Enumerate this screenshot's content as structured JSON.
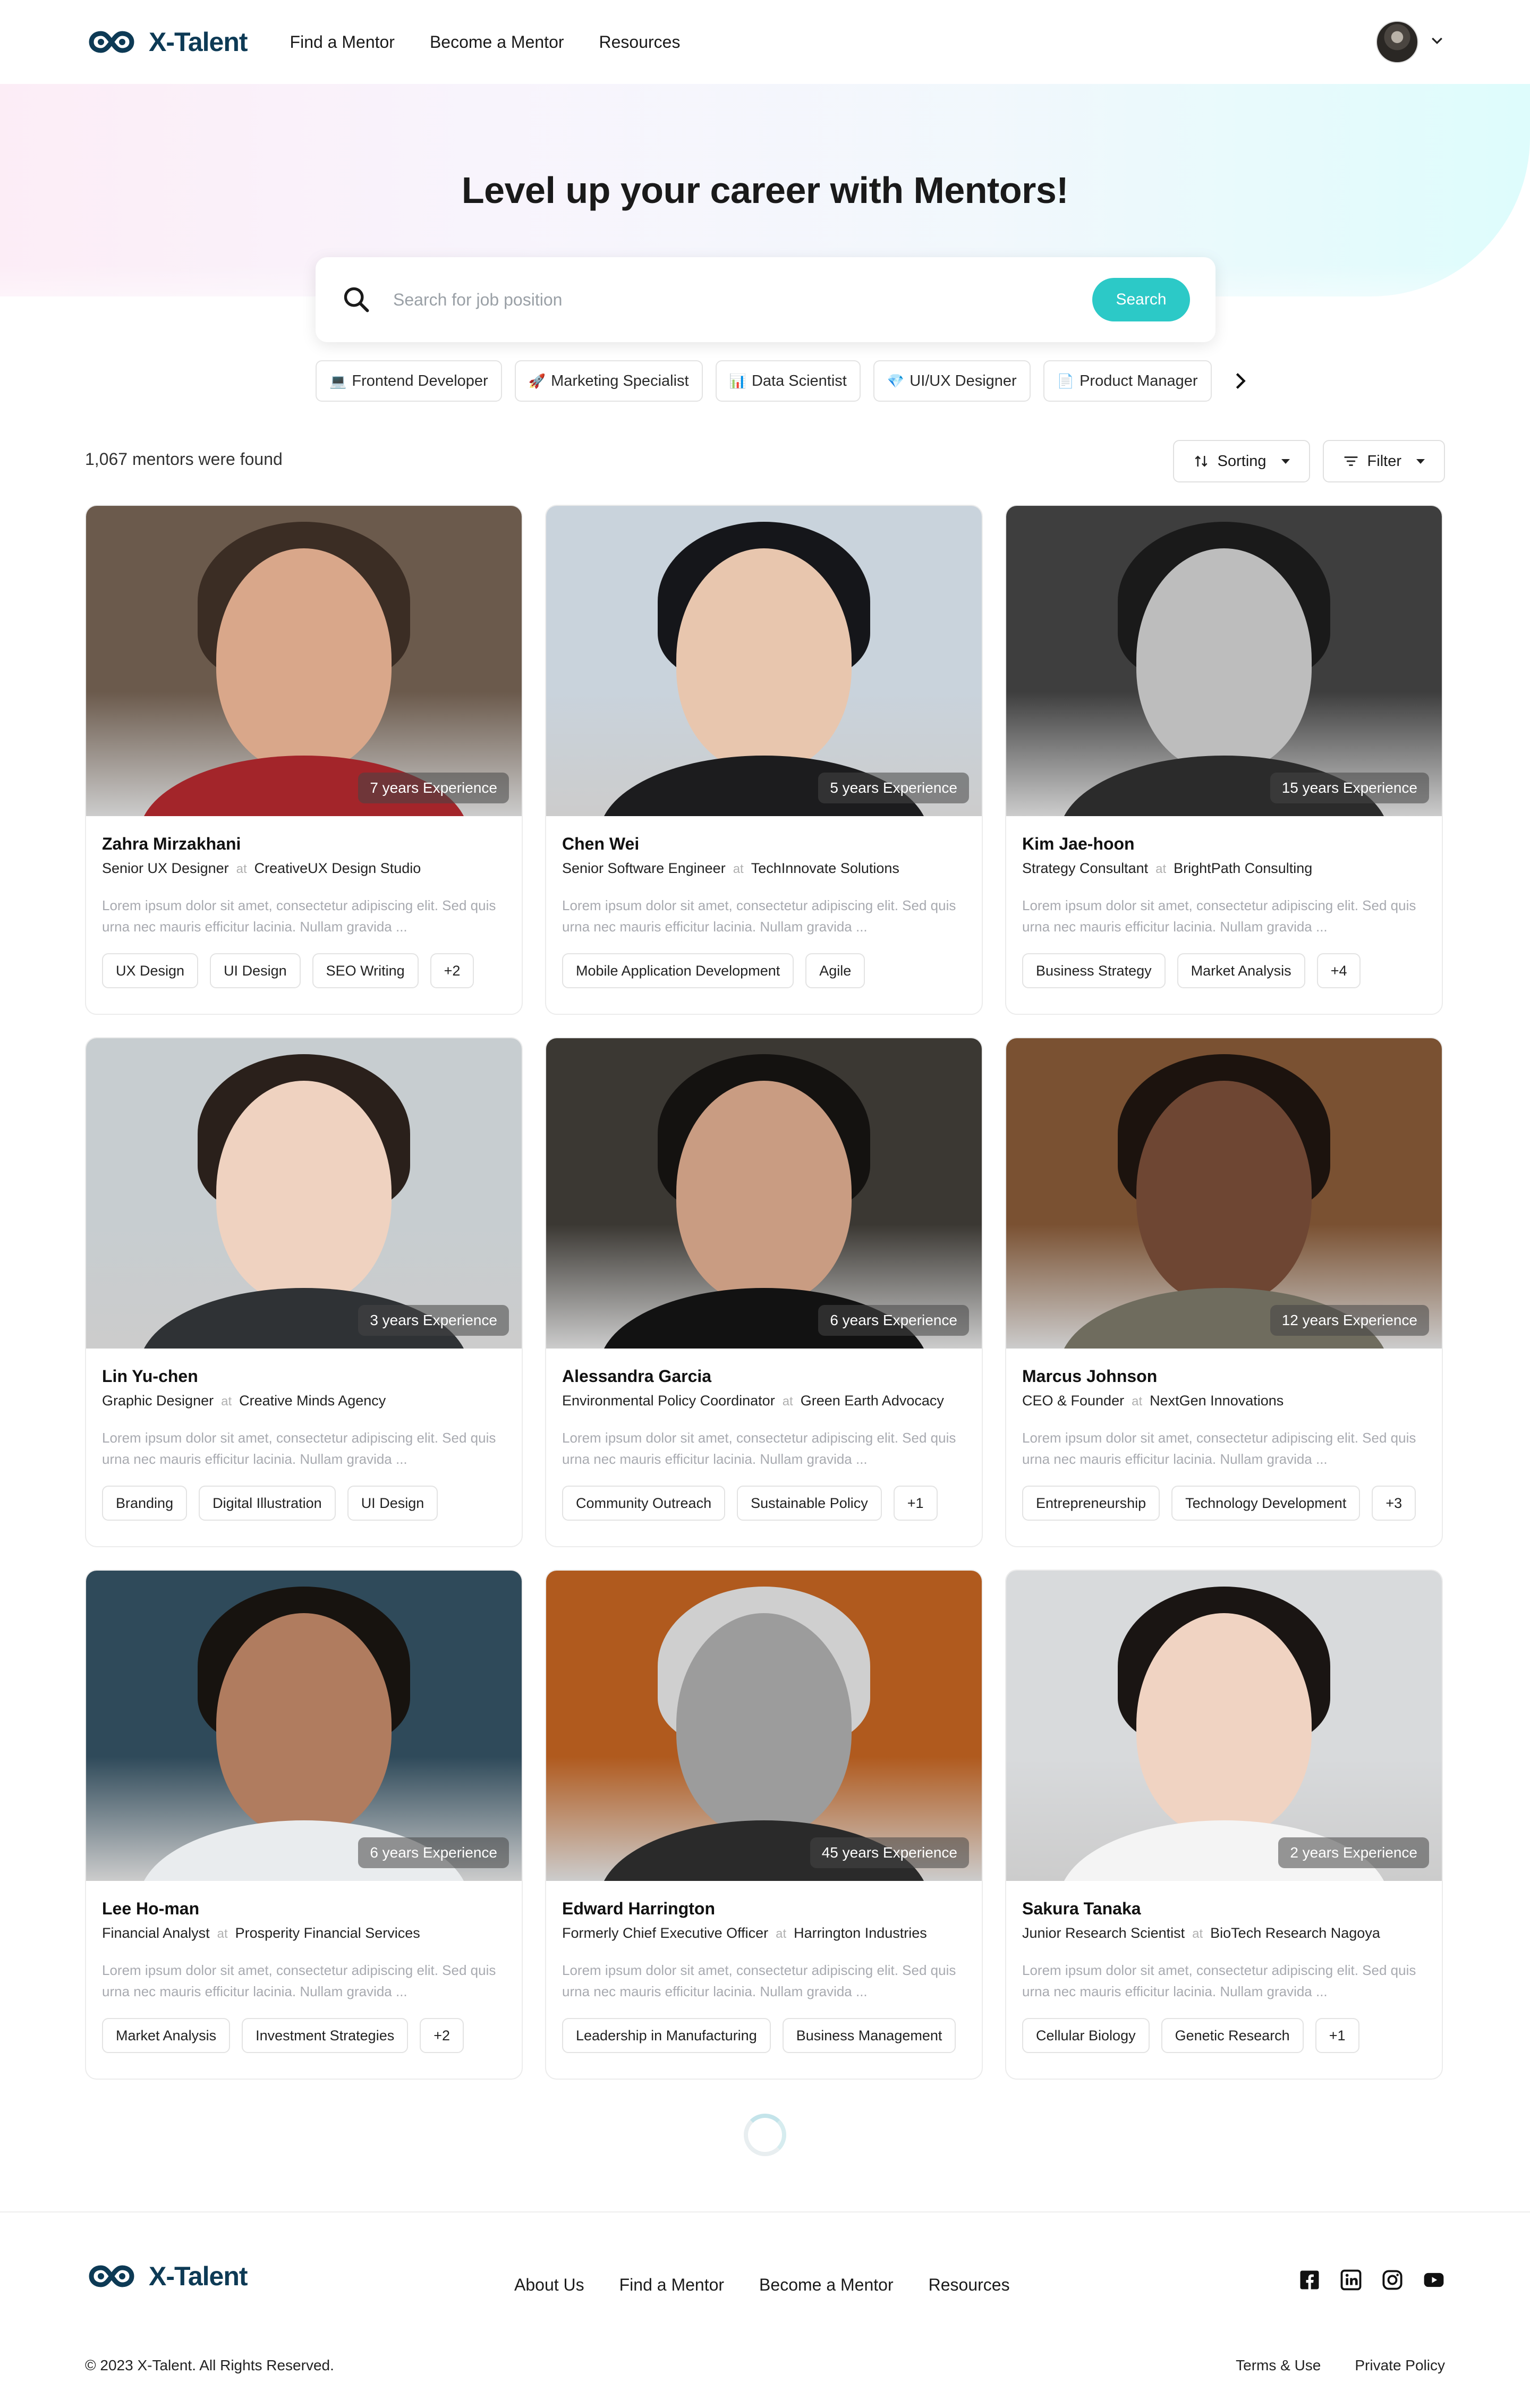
{
  "brand": {
    "name": "X-Talent",
    "teal": "#2cc9c7",
    "navy": "#0d3a55"
  },
  "header": {
    "nav": [
      "Find a Mentor",
      "Become a Mentor",
      "Resources"
    ],
    "user_icon": "avatar",
    "menu_icon": "chevron-down-icon"
  },
  "hero": {
    "title": "Level up your career with Mentors!",
    "search_placeholder": "Search for job position",
    "search_button": "Search"
  },
  "chips": [
    {
      "icon": "💻",
      "label": "Frontend Developer"
    },
    {
      "icon": "🚀",
      "label": "Marketing Specialist"
    },
    {
      "icon": "📊",
      "label": "Data Scientist"
    },
    {
      "icon": "💎",
      "label": "UI/UX Designer"
    },
    {
      "icon": "📄",
      "label": "Product Manager"
    }
  ],
  "results": {
    "count_text": "1,067 mentors were found",
    "sorting": "Sorting",
    "filter": "Filter"
  },
  "mentors": [
    {
      "name": "Zahra Mirzakhani",
      "title": "Senior UX Designer",
      "at": "at",
      "company": "CreativeUX Design Studio",
      "experience": "7 years Experience",
      "desc": "Lorem ipsum dolor sit amet, consectetur adipiscing elit. Sed quis urna nec mauris efficitur lacinia. Nullam gravida ...",
      "tags": [
        "UX Design",
        "UI Design",
        "SEO Writing",
        "+2"
      ]
    },
    {
      "name": "Chen Wei",
      "title": "Senior Software Engineer",
      "at": "at",
      "company": "TechInnovate Solutions",
      "experience": "5 years Experience",
      "desc": "Lorem ipsum dolor sit amet, consectetur adipiscing elit. Sed quis urna nec mauris efficitur lacinia. Nullam gravida ...",
      "tags": [
        "Mobile Application Development",
        "Agile"
      ]
    },
    {
      "name": "Kim Jae-hoon",
      "title": "Strategy Consultant",
      "at": "at",
      "company": "BrightPath Consulting",
      "experience": "15 years Experience",
      "desc": "Lorem ipsum dolor sit amet, consectetur adipiscing elit. Sed quis urna nec mauris efficitur lacinia. Nullam gravida ...",
      "tags": [
        "Business Strategy",
        "Market Analysis",
        "+4"
      ]
    },
    {
      "name": "Lin Yu-chen",
      "title": "Graphic Designer",
      "at": "at",
      "company": "Creative Minds Agency",
      "experience": "3 years Experience",
      "desc": "Lorem ipsum dolor sit amet, consectetur adipiscing elit. Sed quis urna nec mauris efficitur lacinia. Nullam gravida ...",
      "tags": [
        "Branding",
        "Digital Illustration",
        "UI Design"
      ]
    },
    {
      "name": "Alessandra Garcia",
      "title": "Environmental Policy Coordinator",
      "at": "at",
      "company": "Green Earth Advocacy",
      "experience": "6 years Experience",
      "desc": "Lorem ipsum dolor sit amet, consectetur adipiscing elit. Sed quis urna nec mauris efficitur lacinia. Nullam gravida ...",
      "tags": [
        "Community Outreach",
        "Sustainable Policy",
        "+1"
      ]
    },
    {
      "name": "Marcus Johnson",
      "title": "CEO & Founder",
      "at": "at",
      "company": "NextGen Innovations",
      "experience": "12 years Experience",
      "desc": "Lorem ipsum dolor sit amet, consectetur adipiscing elit. Sed quis urna nec mauris efficitur lacinia. Nullam gravida ...",
      "tags": [
        "Entrepreneurship",
        "Technology Development",
        "+3"
      ]
    },
    {
      "name": "Lee Ho-man",
      "title": "Financial Analyst",
      "at": "at",
      "company": "Prosperity Financial Services",
      "experience": "6 years Experience",
      "desc": "Lorem ipsum dolor sit amet, consectetur adipiscing elit. Sed quis urna nec mauris efficitur lacinia. Nullam gravida ...",
      "tags": [
        "Market Analysis",
        "Investment Strategies",
        "+2"
      ]
    },
    {
      "name": "Edward Harrington",
      "title": "Formerly Chief Executive Officer",
      "at": "at",
      "company": "Harrington Industries",
      "experience": "45 years Experience",
      "desc": "Lorem ipsum dolor sit amet, consectetur adipiscing elit. Sed quis urna nec mauris efficitur lacinia. Nullam gravida ...",
      "tags": [
        "Leadership in Manufacturing",
        "Business Management"
      ]
    },
    {
      "name": "Sakura Tanaka",
      "title": "Junior Research Scientist",
      "at": "at",
      "company": "BioTech Research Nagoya",
      "experience": "2 years Experience",
      "desc": "Lorem ipsum dolor sit amet, consectetur adipiscing elit. Sed quis urna nec mauris efficitur lacinia. Nullam gravida ...",
      "tags": [
        "Cellular Biology",
        "Genetic Research",
        "+1"
      ]
    }
  ],
  "photo_palettes": [
    {
      "bg": "#6b5a4c",
      "hair": "#3b2d24",
      "skin": "#d9a78a",
      "body": "#a3252a"
    },
    {
      "bg": "#c9d3dc",
      "hair": "#15161a",
      "skin": "#e8c6ae",
      "body": "#1c1c1e"
    },
    {
      "bg": "#3e3e3e",
      "hair": "#1a1a1a",
      "skin": "#bdbdbd",
      "body": "#2b2b2b"
    },
    {
      "bg": "#c7cdd0",
      "hair": "#2a201b",
      "skin": "#efd2c0",
      "body": "#2f3235"
    },
    {
      "bg": "#3b3833",
      "hair": "#141210",
      "skin": "#c99c82",
      "body": "#121212"
    },
    {
      "bg": "#7a5132",
      "hair": "#1c130e",
      "skin": "#6e4633",
      "body": "#6f6c5e"
    },
    {
      "bg": "#2f4a5a",
      "hair": "#17130f",
      "skin": "#b07c5f",
      "body": "#e9ecee"
    },
    {
      "bg": "#b05a1e",
      "hair": "#cfcfcf",
      "skin": "#9c9c9c",
      "body": "#2a2a2a"
    },
    {
      "bg": "#d8dadc",
      "hair": "#1a1513",
      "skin": "#f0d3c2",
      "body": "#f4f4f4"
    }
  ],
  "footer": {
    "nav": [
      "About Us",
      "Find a Mentor",
      "Become a Mentor",
      "Resources"
    ],
    "social": [
      "facebook-icon",
      "linkedin-icon",
      "instagram-icon",
      "youtube-icon"
    ],
    "copyright": "© 2023 X-Talent. All Rights Reserved.",
    "legal": [
      "Terms & Use",
      "Private Policy"
    ]
  }
}
